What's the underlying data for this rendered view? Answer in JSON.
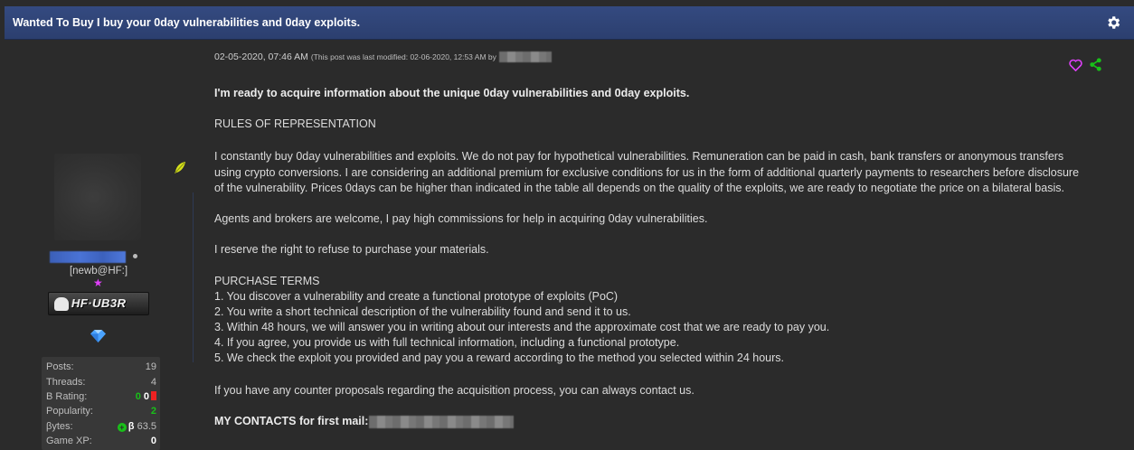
{
  "thread": {
    "title": "Wanted To Buy I buy your 0day vulnerabilities and 0day exploits."
  },
  "icons": {
    "settings": "gear-icon",
    "like": "heart-icon",
    "share": "share-icon",
    "award": "feather-icon",
    "gem": "diamond-icon"
  },
  "colors": {
    "header_bg": "#344a80",
    "heart": "#e040fb",
    "share": "#19c019",
    "positive": "#19c019",
    "negative": "#e22222"
  },
  "author": {
    "usertitle": "[newb@HF:]",
    "userbar_text": "HF·UB3R"
  },
  "stats": {
    "posts_label": "Posts:",
    "posts_value": "19",
    "threads_label": "Threads:",
    "threads_value": "4",
    "rating_label": "B Rating:",
    "rating_pos": "0",
    "rating_neu": "0",
    "popularity_label": "Popularity:",
    "popularity_value": "2",
    "bytes_label": "βytes:",
    "bytes_symbol": "β",
    "bytes_value": "63.5",
    "gamexp_label": "Game XP:",
    "gamexp_value": "0"
  },
  "post": {
    "date": "02-05-2020, 07:46 AM",
    "modified": "(This post was last modified: 02-06-2020, 12:53 AM by",
    "headline": "I'm ready to acquire information about the unique 0day vulnerabilities and 0day exploits.",
    "rules_heading": "RULES OF REPRESENTATION",
    "rules_line1": "I constantly buy 0day vulnerabilities and exploits. We do not pay for hypothetical vulnerabilities. Remuneration can be paid in cash, bank transfers or anonymous transfers",
    "rules_line2": "using crypto conversions. I are considering an additional premium for exclusive conditions for us in the form of additional quarterly payments to researchers before disclosure",
    "rules_line3": "of the vulnerability. Prices 0days can be higher than indicated in the table all depends on the quality of the exploits, we are ready to negotiate the price on a bilateral basis.",
    "agents": "Agents and brokers are welcome, I pay high commissions for help in acquiring 0day vulnerabilities.",
    "reserve": "I reserve the right to refuse to purchase your materials.",
    "terms_heading": "PURCHASE TERMS",
    "terms": [
      "1. You discover a vulnerability and create a functional prototype of exploits (PoC)",
      "2. You write a short technical description of the vulnerability found and send it to us.",
      "3. Within 48 hours, we will answer you in writing about our interests and the approximate cost that we are ready to pay you.",
      "4. If you agree, you provide us with full technical information, including a functional prototype.",
      "5. We check the exploit you provided and pay you a reward according to the method you selected within 24 hours."
    ],
    "counter": "If you have any counter proposals regarding the acquisition process, you can always contact us.",
    "contacts_label": "MY CONTACTS for first mail:"
  }
}
